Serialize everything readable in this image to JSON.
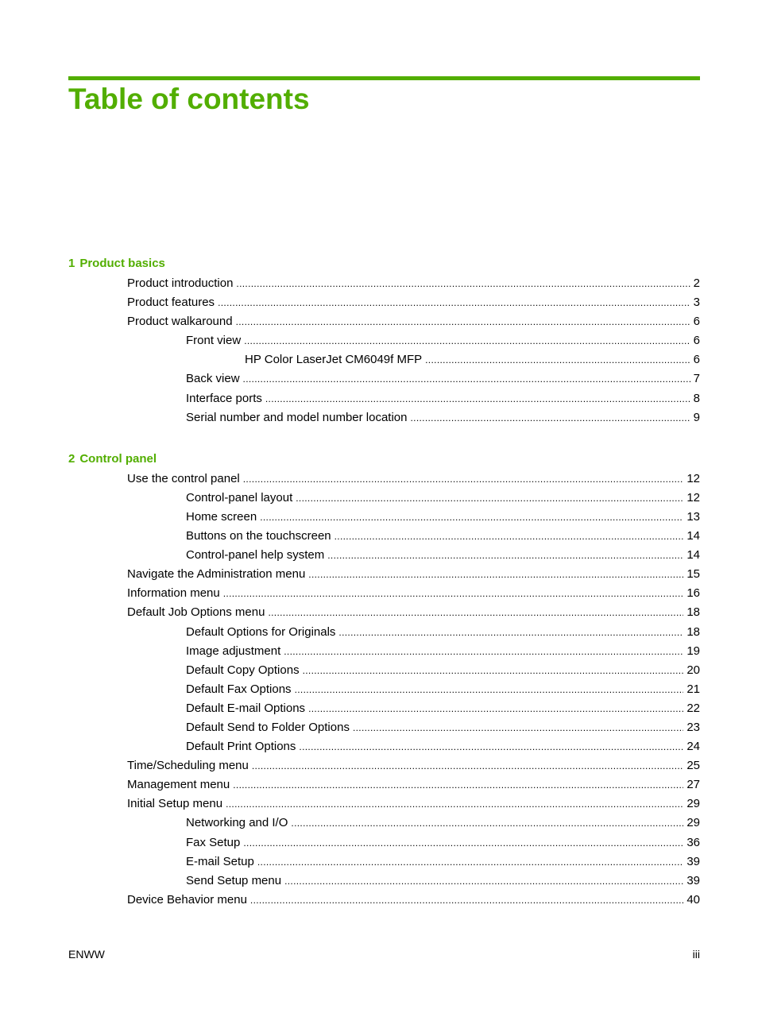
{
  "document": {
    "title": "Table of contents",
    "accent_color": "#52ae00",
    "chapters": [
      {
        "number": "1",
        "title": "Product basics",
        "entries": [
          {
            "level": 1,
            "label": "Product introduction",
            "page": "2"
          },
          {
            "level": 1,
            "label": "Product features",
            "page": "3"
          },
          {
            "level": 1,
            "label": "Product walkaround",
            "page": "6"
          },
          {
            "level": 2,
            "label": "Front view",
            "page": "6"
          },
          {
            "level": 3,
            "label": "HP Color LaserJet CM6049f MFP",
            "page": "6"
          },
          {
            "level": 2,
            "label": "Back view",
            "page": "7"
          },
          {
            "level": 2,
            "label": "Interface ports",
            "page": "8"
          },
          {
            "level": 2,
            "label": "Serial number and model number location",
            "page": "9"
          }
        ]
      },
      {
        "number": "2",
        "title": "Control panel",
        "entries": [
          {
            "level": 1,
            "label": "Use the control panel",
            "page": "12"
          },
          {
            "level": 2,
            "label": "Control-panel layout",
            "page": "12"
          },
          {
            "level": 2,
            "label": "Home screen",
            "page": "13"
          },
          {
            "level": 2,
            "label": "Buttons on the touchscreen",
            "page": "14"
          },
          {
            "level": 2,
            "label": "Control-panel help system",
            "page": "14"
          },
          {
            "level": 1,
            "label": "Navigate the Administration menu",
            "page": "15"
          },
          {
            "level": 1,
            "label": "Information menu",
            "page": "16"
          },
          {
            "level": 1,
            "label": "Default Job Options menu",
            "page": "18"
          },
          {
            "level": 2,
            "label": "Default Options for Originals",
            "page": "18"
          },
          {
            "level": 2,
            "label": "Image adjustment",
            "page": "19"
          },
          {
            "level": 2,
            "label": "Default Copy Options",
            "page": "20"
          },
          {
            "level": 2,
            "label": "Default Fax Options",
            "page": "21"
          },
          {
            "level": 2,
            "label": "Default E-mail Options",
            "page": "22"
          },
          {
            "level": 2,
            "label": "Default Send to Folder Options",
            "page": "23"
          },
          {
            "level": 2,
            "label": "Default Print Options",
            "page": "24"
          },
          {
            "level": 1,
            "label": "Time/Scheduling menu",
            "page": "25"
          },
          {
            "level": 1,
            "label": "Management menu",
            "page": "27"
          },
          {
            "level": 1,
            "label": "Initial Setup menu",
            "page": "29"
          },
          {
            "level": 2,
            "label": "Networking and I/O",
            "page": "29"
          },
          {
            "level": 2,
            "label": "Fax Setup",
            "page": "36"
          },
          {
            "level": 2,
            "label": "E-mail Setup",
            "page": "39"
          },
          {
            "level": 2,
            "label": "Send Setup menu",
            "page": "39"
          },
          {
            "level": 1,
            "label": "Device Behavior menu",
            "page": "40"
          }
        ]
      }
    ],
    "footer": {
      "left": "ENWW",
      "right": "iii"
    }
  }
}
